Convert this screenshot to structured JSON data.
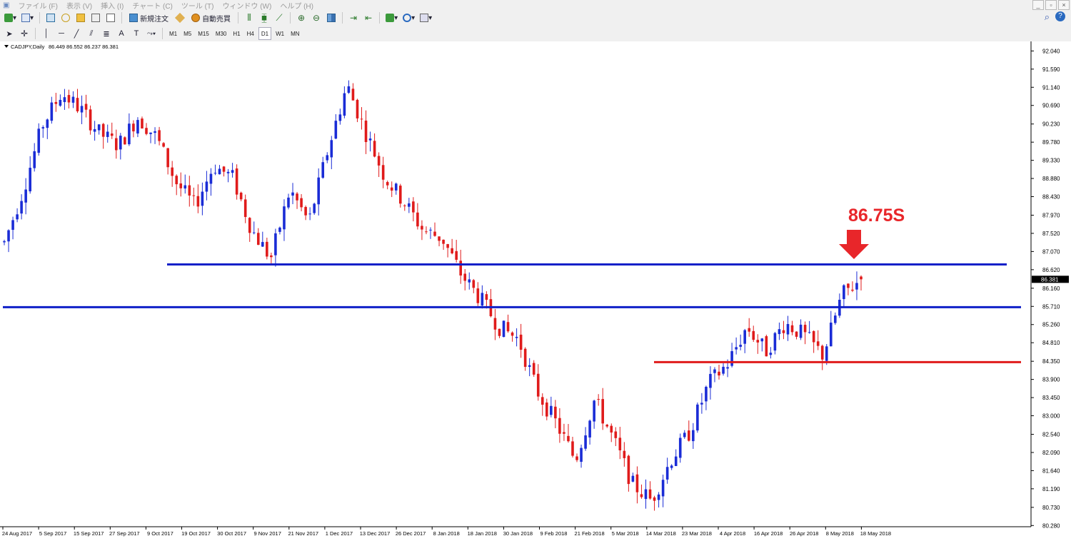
{
  "menu": {
    "items": [
      "ファイル (F)",
      "表示 (V)",
      "挿入 (I)",
      "チャート (C)",
      "ツール (T)",
      "ウィンドウ (W)",
      "ヘルプ (H)"
    ],
    "window_controls": [
      "_",
      "▫",
      "×"
    ]
  },
  "toolbar": {
    "new_order_label": "新規注文",
    "auto_trade_label": "自動売買",
    "timeframes": [
      "M1",
      "M5",
      "M15",
      "M30",
      "H1",
      "H4",
      "D1",
      "W1",
      "MN"
    ],
    "active_timeframe": "D1"
  },
  "chart_header": {
    "symbol": "CADJPY,Daily",
    "ohlc": "86.449 86.552 86.237 86.381"
  },
  "annotation": {
    "text": "86.75S",
    "color": "#e8262a"
  },
  "colors": {
    "bull": "#1a2cd6",
    "bear": "#e01b1b",
    "hline_blue": "#1020c8",
    "hline_red": "#e01b1b"
  },
  "chart_data": {
    "type": "candlestick",
    "ylim": [
      80.25,
      92.1
    ],
    "price_ticks": [
      "92.040",
      "91.590",
      "91.140",
      "90.690",
      "90.230",
      "89.780",
      "89.330",
      "88.880",
      "88.430",
      "87.970",
      "87.520",
      "87.070",
      "86.620",
      "86.160",
      "85.710",
      "85.260",
      "84.810",
      "84.350",
      "83.900",
      "83.450",
      "83.000",
      "82.540",
      "82.090",
      "81.640",
      "81.190",
      "80.730",
      "80.280"
    ],
    "current_price": "86.381",
    "date_labels": [
      "24 Aug 2017",
      "5 Sep 2017",
      "15 Sep 2017",
      "27 Sep 2017",
      "9 Oct 2017",
      "19 Oct 2017",
      "30 Oct 2017",
      "9 Nov 2017",
      "21 Nov 2017",
      "1 Dec 2017",
      "13 Dec 2017",
      "26 Dec 2017",
      "8 Jan 2018",
      "18 Jan 2018",
      "30 Jan 2018",
      "9 Feb 2018",
      "21 Feb 2018",
      "5 Mar 2018",
      "14 Mar 2018",
      "23 Mar 2018",
      "4 Apr 2018",
      "16 Apr 2018",
      "26 Apr 2018",
      "8 May 2018",
      "18 May 2018"
    ],
    "close_path": [
      87.3,
      88.6,
      90.2,
      91.0,
      90.6,
      90.0,
      89.7,
      90.4,
      89.9,
      88.8,
      88.2,
      89.2,
      88.9,
      87.6,
      86.9,
      88.6,
      87.8,
      89.6,
      91.2,
      90.0,
      88.9,
      88.3,
      87.6,
      87.4,
      86.5,
      85.9,
      85.2,
      84.9,
      83.6,
      82.8,
      81.9,
      83.4,
      82.4,
      81.3,
      80.9,
      81.9,
      82.6,
      83.8,
      84.3,
      85.2,
      84.6,
      85.3,
      85.0,
      84.5,
      86.0,
      86.38
    ],
    "horizontal_lines": [
      {
        "name": "resistance-86.75",
        "price": 86.75,
        "color": "blue",
        "from_date": "13 Nov 2017",
        "to_date": "May 2018"
      },
      {
        "name": "support-85.69",
        "price": 85.69,
        "color": "blue",
        "from_date": "Aug 2017",
        "to_date": "May 2018"
      },
      {
        "name": "support-84.33",
        "price": 84.33,
        "color": "red",
        "from_date": "Mar 2018",
        "to_date": "May 2018"
      }
    ]
  }
}
